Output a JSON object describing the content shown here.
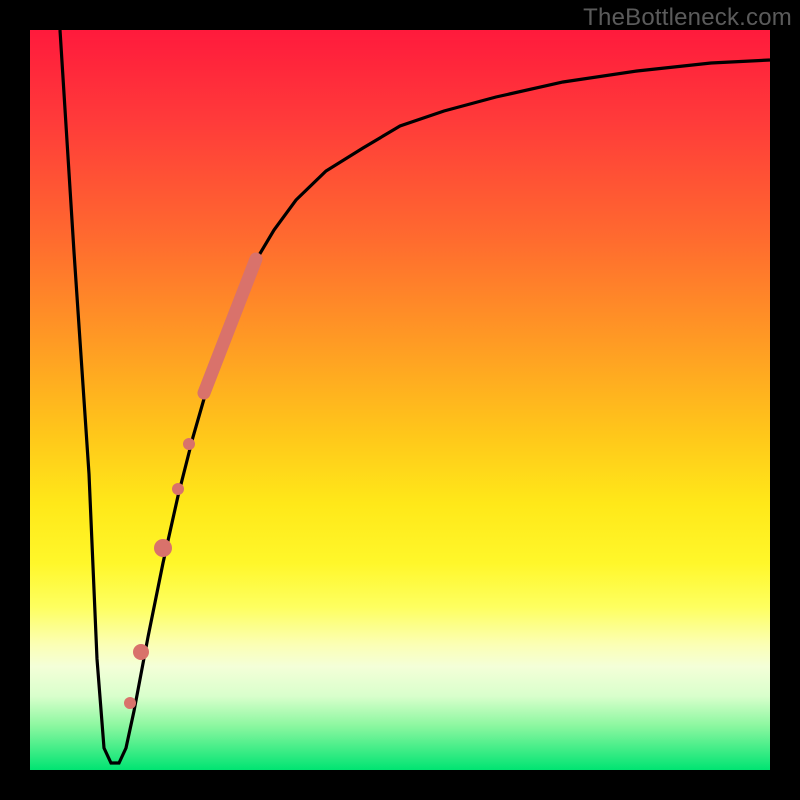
{
  "watermark": "TheBottleneck.com",
  "colors": {
    "background": "#000000",
    "curve": "#000000",
    "marker_fill": "#d9726b",
    "marker_stroke": "#b94f49"
  },
  "chart_data": {
    "type": "line",
    "title": "",
    "xlabel": "",
    "ylabel": "",
    "xlim": [
      0,
      100
    ],
    "ylim": [
      0,
      100
    ],
    "grid": false,
    "legend": false,
    "note": "Axes unlabeled; values are relative positions read from pixel geometry (0–100). y=100 near top (red / worst), y≈0 near bottom (green / best).",
    "series": [
      {
        "name": "bottleneck-curve",
        "x": [
          4,
          6,
          8,
          9,
          10,
          11,
          12,
          13,
          14,
          16,
          18,
          20,
          22,
          24,
          26,
          28,
          30,
          33,
          36,
          40,
          45,
          50,
          56,
          63,
          72,
          82,
          92,
          100
        ],
        "y": [
          100,
          70,
          40,
          15,
          3,
          1,
          1,
          3,
          8,
          18,
          28,
          37,
          45,
          52,
          58,
          63,
          68,
          73,
          77,
          81,
          84,
          87,
          89,
          91,
          93,
          94.5,
          95.5,
          96
        ]
      }
    ],
    "markers": [
      {
        "name": "highlight-band",
        "shape": "segment",
        "x_from": 23.5,
        "y_from": 51,
        "x_to": 30.5,
        "y_to": 69,
        "width": 12
      },
      {
        "name": "dot-1",
        "shape": "circle",
        "x": 21.5,
        "y": 44,
        "r": 6
      },
      {
        "name": "dot-2",
        "shape": "circle",
        "x": 20.0,
        "y": 38,
        "r": 6
      },
      {
        "name": "dot-3",
        "shape": "circle",
        "x": 18.0,
        "y": 30,
        "r": 8
      },
      {
        "name": "dot-4",
        "shape": "circle",
        "x": 15.0,
        "y": 16,
        "r": 7
      },
      {
        "name": "dot-5",
        "shape": "circle",
        "x": 13.5,
        "y": 9,
        "r": 6
      }
    ]
  }
}
